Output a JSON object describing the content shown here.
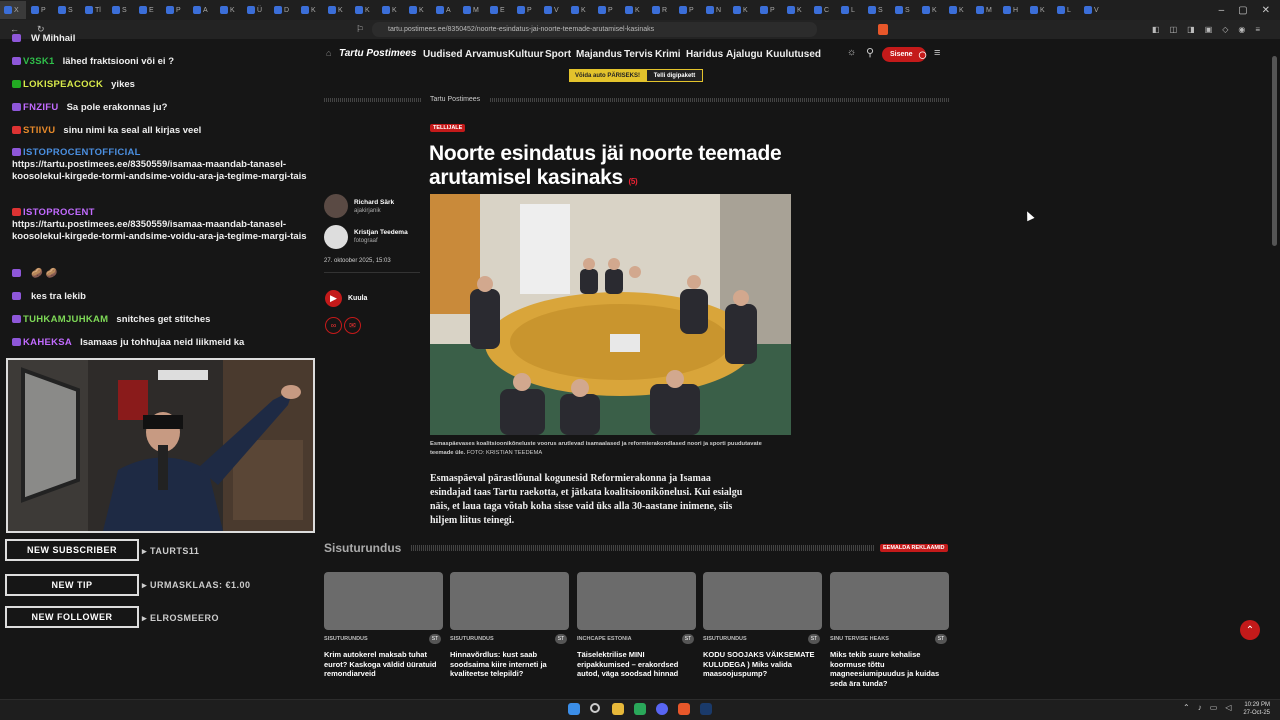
{
  "browser": {
    "url": "tartu.postimees.ee/8350452/noorte-esindatus-jai-noorte-teemade-arutamisel-kasinaks",
    "tabs": [
      "X",
      "P",
      "S",
      "Tl",
      "S",
      "E",
      "P",
      "A",
      "K",
      "Ü",
      "D",
      "K",
      "K",
      "K",
      "K",
      "K",
      "A",
      "M",
      "E",
      "P",
      "V",
      "K",
      "P",
      "K",
      "R",
      "P",
      "N",
      "K",
      "P",
      "K",
      "C",
      "L",
      "S",
      "S",
      "K",
      "K",
      "M",
      "H",
      "K",
      "L",
      "V"
    ]
  },
  "chat": {
    "messages": [
      {
        "user": "",
        "text": "W Mihhail",
        "badge": "purple",
        "color": "#8e57d9"
      },
      {
        "user": "V3SK1",
        "text": "lähed fraktsiooni või ei ?",
        "badge": "purple",
        "color": "#2fbf4a"
      },
      {
        "user": "LOKISPEACOCK",
        "text": "yikes",
        "badge": "green",
        "color": "#d7e94a"
      },
      {
        "user": "FNZIFU",
        "text": "Sa pole erakonnas ju?",
        "badge": "purple",
        "color": "#c26bff"
      },
      {
        "user": "STIIVU",
        "text": "sinu nimi ka seal all kirjas veel",
        "badge": "red",
        "color": "#e88a2a"
      },
      {
        "user": "ISTOPROCENTOFFICIAL",
        "text": "https://tartu.postimees.ee/8350559/isamaa-maandab-tanasel-koosolekul-kirgede-tormi-andsime-voidu-ara-ja-tegime-margi-tais",
        "badge": "purple",
        "color": "#4b8fe0"
      },
      {
        "user": "ISTOPROCENT",
        "text": "https://tartu.postimees.ee/8350559/isamaa-maandab-tanasel-koosolekul-kirgede-tormi-andsime-voidu-ara-ja-tegime-margi-tais",
        "badge": "red",
        "color": "#c26bff"
      },
      {
        "user": "",
        "text": "🥔 🥔",
        "badge": "purple",
        "color": "#8e57d9"
      },
      {
        "user": "",
        "text": "kes tra lekib",
        "badge": "purple",
        "color": "#3b5fc0"
      },
      {
        "user": "TUHKAMJUHKAM",
        "text": "snitches get stitches",
        "badge": "purple",
        "color": "#7ed957"
      },
      {
        "user": "KAHEKSA",
        "text": "Isamaas ju tohhujaa neid liikmeid ka",
        "badge": "purple",
        "color": "#c26bff"
      }
    ]
  },
  "alerts": {
    "subscriber_label": "NEW SUBSCRIBER",
    "subscriber_value": "TAURTS11",
    "tip_label": "NEW TIP",
    "tip_value": "URMASKLAAS: €1.00",
    "follower_label": "NEW FOLLOWER",
    "follower_value": "ELROSMEERO"
  },
  "site": {
    "logo": "Tartu Postimees",
    "nav": [
      "Uudised",
      "Arvamus",
      "Kultuur",
      "Sport",
      "Majandus",
      "Tervis",
      "Krimi",
      "Haridus",
      "Ajalugu",
      "Kuulutused"
    ],
    "login": "Sisene",
    "promo1": "Võida auto PÄRISEKS!",
    "promo2": "Telli digipakett",
    "section": "Tartu Postimees",
    "tag": "TELLIJALE",
    "headline": "Noorte esindatus jäi noorte teemade arutamisel kasinaks",
    "comments": "(5)",
    "author1_name": "Richard Särk",
    "author1_role": "ajakirjanik",
    "author2_name": "Kristjan Teedema",
    "author2_role": "fotograaf",
    "date": "27. oktoober 2025, 15:03",
    "listen": "Kuula",
    "caption": "Esmaspäevases koalitsioonikõneluste voorus arutlevad isamaalased ja reformierakondlased noori ja sporti puudutavate teemade üle.",
    "caption_credit": "FOTO: KRISTIAN TEEDEMA",
    "lead": "Esmaspäeval pärastlõunal kogunesid Reformierakonna ja Isamaa esindajad taas Tartu raekotta, et jätkata koalitsioonikõnelusi. Kui esialgu näis, et laua taga võtab koha sisse vaid üks alla 30-aastane inimene, siis hiljem liitus teinegi.",
    "sisuturundus": "Sisuturundus",
    "remove_ads": "EEMALDA REKLAAMID",
    "cards": [
      {
        "src": "SISUTURUNDUS",
        "title": "Krim autokerel maksab tuhat eurot? Kaskoga väldid üüratuid remondiarveid"
      },
      {
        "src": "SISUTURUNDUS",
        "title": "Hinnavõrdlus: kust saab soodsaima kiire interneti ja kvaliteetse telepildi?"
      },
      {
        "src": "INCHCAPE ESTONIA",
        "title": "Täiselektrilise MINI eripakkumised – erakordsed autod, väga soodsad hinnad"
      },
      {
        "src": "SISUTURUNDUS",
        "title": "KODU SOOJAKS VÄIKSEMATE KULUDEGA ) Miks valida maasoojuspump?"
      },
      {
        "src": "SINU TERVISE HEAKS",
        "title": "Miks tekib suure kehalise koormuse tõttu magneesiumipuudus ja kuidas seda ära tunda?"
      }
    ],
    "st_badge": "ST"
  },
  "system": {
    "time": "10:29 PM",
    "date": "27-Oct-25"
  }
}
